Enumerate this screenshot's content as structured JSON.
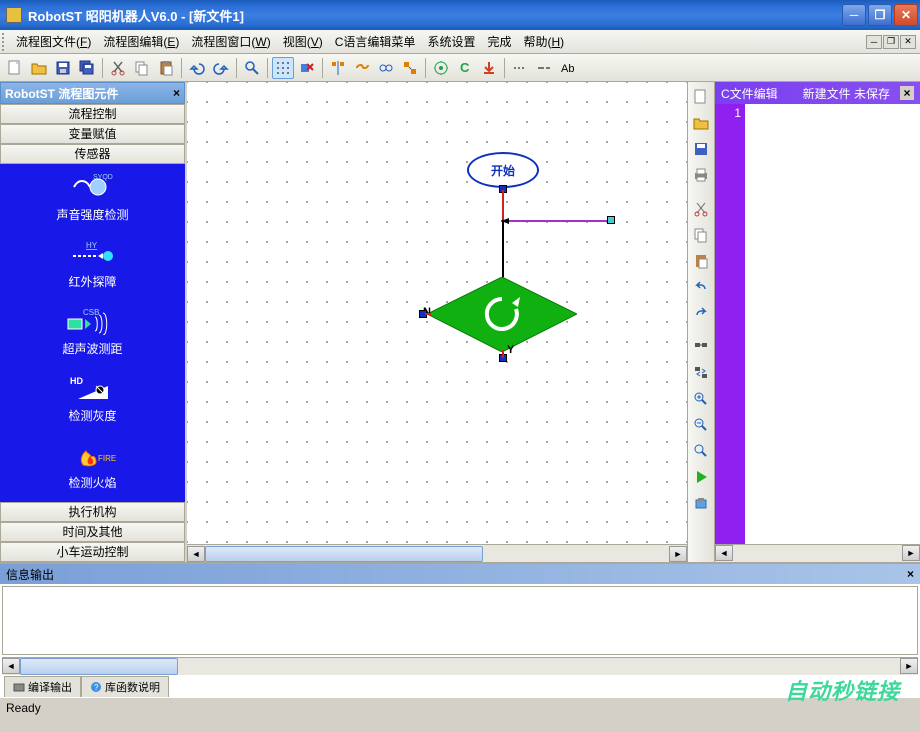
{
  "window": {
    "title": "RobotST 昭阳机器人V6.0   - [新文件1]"
  },
  "menu": {
    "items": [
      {
        "label": "流程图文件",
        "key": "F"
      },
      {
        "label": "流程图编辑",
        "key": "E"
      },
      {
        "label": "流程图窗口",
        "key": "W"
      },
      {
        "label": "视图",
        "key": "V"
      },
      {
        "label": "C语言编辑菜单",
        "key": ""
      },
      {
        "label": "系统设置",
        "key": ""
      },
      {
        "label": "完成",
        "key": ""
      },
      {
        "label": "帮助",
        "key": "H"
      }
    ]
  },
  "toolbar": {
    "icons": [
      "new",
      "open",
      "save",
      "saveall",
      "cut",
      "copy",
      "paste",
      "undo",
      "redo",
      "zoom",
      "grid",
      "del-node",
      "align",
      "link",
      "unlink",
      "group",
      "build",
      "c-lang",
      "download",
      "hline",
      "vline",
      "text"
    ]
  },
  "left_panel": {
    "title": "RobotST 流程图元件",
    "categories_top": [
      "流程控制",
      "变量赋值",
      "传感器"
    ],
    "sensors": [
      {
        "name": "声音强度检测",
        "tag": "SYQD"
      },
      {
        "name": "红外探障",
        "tag": "HY"
      },
      {
        "name": "超声波测距",
        "tag": "CSB"
      },
      {
        "name": "检测灰度",
        "tag": "HD"
      },
      {
        "name": "检测火焰",
        "tag": "FIRE"
      }
    ],
    "categories_bottom": [
      "执行机构",
      "时间及其他",
      "小车运动控制"
    ]
  },
  "canvas": {
    "start_label": "开始",
    "branch_n": "N",
    "branch_y": "Y"
  },
  "side_toolbar": {
    "icons": [
      "new",
      "open",
      "save",
      "print",
      "cut",
      "copy",
      "paste",
      "undo",
      "redo",
      "find",
      "replace",
      "zoomin",
      "zoomout",
      "zoomfit",
      "run",
      "settings"
    ]
  },
  "right_panel": {
    "title_left": "C文件编辑",
    "title_right": "新建文件 未保存",
    "line_num": "1"
  },
  "output": {
    "title": "信息输出",
    "tabs": [
      "编译输出",
      "库函数说明"
    ]
  },
  "status": {
    "text": "Ready"
  },
  "watermark": "自动秒链接"
}
